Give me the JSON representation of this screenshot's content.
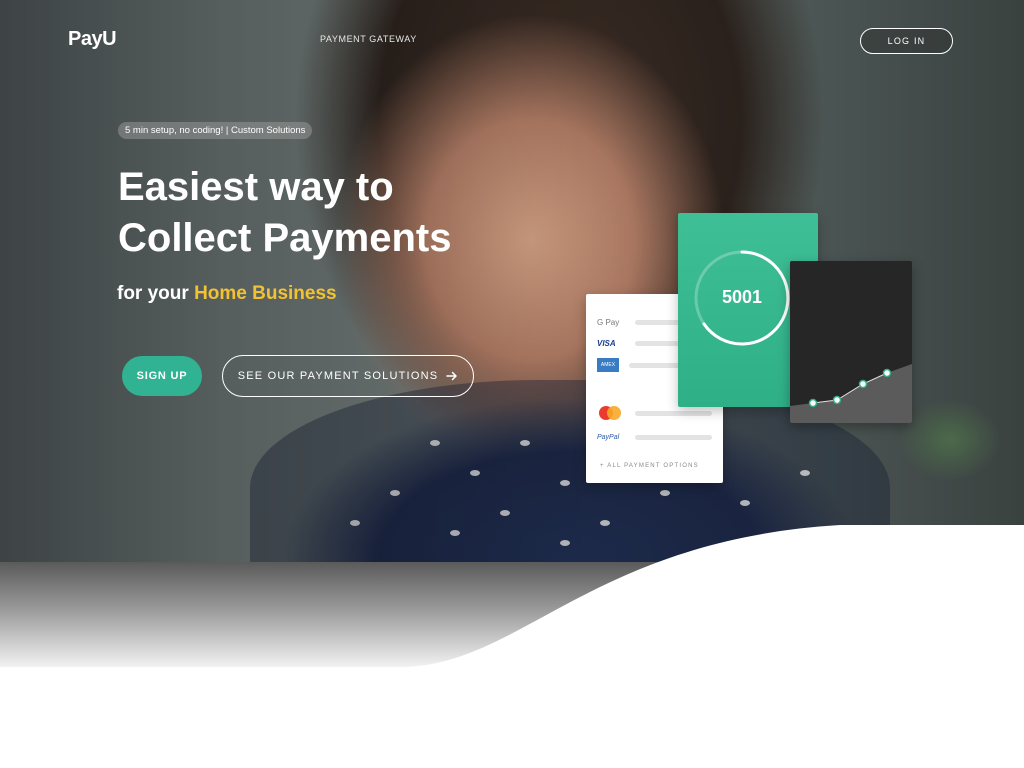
{
  "brand": {
    "logo_text": "PayU"
  },
  "nav": {
    "links": [
      "PAYMENT GATEWAY"
    ],
    "login_label": "LOG IN"
  },
  "hero": {
    "pill": "5 min setup, no coding! | Custom Solutions",
    "headline_line1": "Easiest way to",
    "headline_line2": "Collect Payments",
    "sub_prefix": "for your",
    "sub_highlight": "Home Business",
    "signup_label": "SIGN UP",
    "solutions_label": "SEE OUR PAYMENT SOLUTIONS",
    "solutions_icon": "arrow-right-icon"
  },
  "cards": {
    "payment_methods": [
      "G Pay",
      "VISA",
      "AMEX",
      "Mastercard",
      "PayPal"
    ],
    "all_options_label": "+ ALL PAYMENT OPTIONS",
    "counter_value": "5001"
  },
  "colors": {
    "accent_green": "#31b292",
    "highlight_yellow": "#f2c232"
  }
}
